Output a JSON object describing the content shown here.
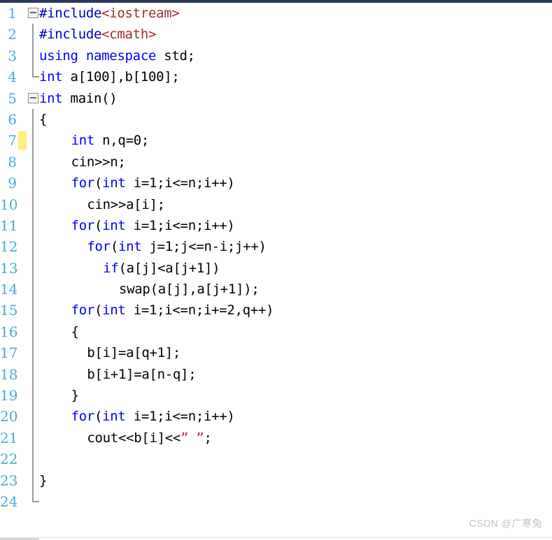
{
  "editor": {
    "language": "C++",
    "total_lines": 24,
    "colors": {
      "keyword": "#0000ff",
      "preprocessor": "#0000c8",
      "header": "#a52a2a",
      "string": "#c03030",
      "plain_text": "#000000",
      "line_number": "#4aa8d8",
      "modified_marker": "#ffef80",
      "fold_guide": "#9a9a9a",
      "background": "#ffffff",
      "top_strip": "#2b3a5c"
    }
  },
  "lines": [
    {
      "number": "1",
      "indent": 0,
      "fold": "open",
      "guide": "none",
      "modified": false,
      "tokens": [
        {
          "t": "#include",
          "c": "pre"
        },
        {
          "t": "<iostream>",
          "c": "hdr"
        }
      ]
    },
    {
      "number": "2",
      "indent": 0,
      "fold": "none",
      "guide": "line",
      "modified": false,
      "tokens": [
        {
          "t": "#include",
          "c": "pre"
        },
        {
          "t": "<cmath>",
          "c": "hdr"
        }
      ]
    },
    {
      "number": "3",
      "indent": 0,
      "fold": "none",
      "guide": "line",
      "modified": false,
      "tokens": [
        {
          "t": "using",
          "c": "kw"
        },
        {
          "t": " ",
          "c": "plain"
        },
        {
          "t": "namespace",
          "c": "kw"
        },
        {
          "t": " std;",
          "c": "plain"
        }
      ]
    },
    {
      "number": "4",
      "indent": 0,
      "fold": "none",
      "guide": "end",
      "modified": false,
      "tokens": [
        {
          "t": "int",
          "c": "kw"
        },
        {
          "t": " a[100],b[100];",
          "c": "plain"
        }
      ]
    },
    {
      "number": "5",
      "indent": 0,
      "fold": "open",
      "guide": "none",
      "modified": false,
      "tokens": [
        {
          "t": "int",
          "c": "kw"
        },
        {
          "t": " main()",
          "c": "plain"
        }
      ]
    },
    {
      "number": "6",
      "indent": 0,
      "fold": "none",
      "guide": "line",
      "modified": false,
      "tokens": [
        {
          "t": "{",
          "c": "plain"
        }
      ]
    },
    {
      "number": "7",
      "indent": 4,
      "fold": "none",
      "guide": "line",
      "modified": true,
      "tokens": [
        {
          "t": "int",
          "c": "kw"
        },
        {
          "t": " n,q=0;",
          "c": "plain"
        }
      ]
    },
    {
      "number": "8",
      "indent": 4,
      "fold": "none",
      "guide": "line",
      "modified": false,
      "tokens": [
        {
          "t": "cin>>n;",
          "c": "plain"
        }
      ]
    },
    {
      "number": "9",
      "indent": 4,
      "fold": "none",
      "guide": "line",
      "modified": false,
      "tokens": [
        {
          "t": "for",
          "c": "kw"
        },
        {
          "t": "(",
          "c": "plain"
        },
        {
          "t": "int",
          "c": "kw"
        },
        {
          "t": " i=1;i<=n;i++)",
          "c": "plain"
        }
      ]
    },
    {
      "number": "10",
      "indent": 6,
      "fold": "none",
      "guide": "line",
      "modified": false,
      "tokens": [
        {
          "t": "cin>>a[i];",
          "c": "plain"
        }
      ]
    },
    {
      "number": "11",
      "indent": 4,
      "fold": "none",
      "guide": "line",
      "modified": false,
      "tokens": [
        {
          "t": "for",
          "c": "kw"
        },
        {
          "t": "(",
          "c": "plain"
        },
        {
          "t": "int",
          "c": "kw"
        },
        {
          "t": " i=1;i<=n;i++)",
          "c": "plain"
        }
      ]
    },
    {
      "number": "12",
      "indent": 6,
      "fold": "none",
      "guide": "line",
      "modified": false,
      "tokens": [
        {
          "t": "for",
          "c": "kw"
        },
        {
          "t": "(",
          "c": "plain"
        },
        {
          "t": "int",
          "c": "kw"
        },
        {
          "t": " j=1;j<=n-i;j++)",
          "c": "plain"
        }
      ]
    },
    {
      "number": "13",
      "indent": 8,
      "fold": "none",
      "guide": "line",
      "modified": false,
      "tokens": [
        {
          "t": "if",
          "c": "kw"
        },
        {
          "t": "(a[j]<a[j+1])",
          "c": "plain"
        }
      ]
    },
    {
      "number": "14",
      "indent": 10,
      "fold": "none",
      "guide": "line",
      "modified": false,
      "tokens": [
        {
          "t": "swap(a[j],a[j+1]);",
          "c": "plain"
        }
      ]
    },
    {
      "number": "15",
      "indent": 4,
      "fold": "none",
      "guide": "line",
      "modified": false,
      "tokens": [
        {
          "t": "for",
          "c": "kw"
        },
        {
          "t": "(",
          "c": "plain"
        },
        {
          "t": "int",
          "c": "kw"
        },
        {
          "t": " i=1;i<=n;i+=2,q++)",
          "c": "plain"
        }
      ]
    },
    {
      "number": "16",
      "indent": 4,
      "fold": "none",
      "guide": "line",
      "modified": false,
      "tokens": [
        {
          "t": "{",
          "c": "plain"
        }
      ]
    },
    {
      "number": "17",
      "indent": 6,
      "fold": "none",
      "guide": "line",
      "modified": false,
      "tokens": [
        {
          "t": "b[i]=a[q+1];",
          "c": "plain"
        }
      ]
    },
    {
      "number": "18",
      "indent": 6,
      "fold": "none",
      "guide": "line",
      "modified": false,
      "tokens": [
        {
          "t": "b[i+1]=a[n-q];",
          "c": "plain"
        }
      ]
    },
    {
      "number": "19",
      "indent": 4,
      "fold": "none",
      "guide": "line",
      "modified": false,
      "tokens": [
        {
          "t": "}",
          "c": "plain"
        }
      ]
    },
    {
      "number": "20",
      "indent": 4,
      "fold": "none",
      "guide": "line",
      "modified": false,
      "tokens": [
        {
          "t": "for",
          "c": "kw"
        },
        {
          "t": "(",
          "c": "plain"
        },
        {
          "t": "int",
          "c": "kw"
        },
        {
          "t": " i=1;i<=n;i++)",
          "c": "plain"
        }
      ]
    },
    {
      "number": "21",
      "indent": 6,
      "fold": "none",
      "guide": "line",
      "modified": false,
      "tokens": [
        {
          "t": "cout<<b[i]<<",
          "c": "plain"
        },
        {
          "t": "” ”",
          "c": "str"
        },
        {
          "t": ";",
          "c": "plain"
        }
      ]
    },
    {
      "number": "22",
      "indent": 0,
      "fold": "none",
      "guide": "line",
      "modified": false,
      "tokens": []
    },
    {
      "number": "23",
      "indent": 0,
      "fold": "none",
      "guide": "line",
      "modified": false,
      "tokens": [
        {
          "t": "}",
          "c": "plain"
        }
      ]
    },
    {
      "number": "24",
      "indent": 0,
      "fold": "none",
      "guide": "end",
      "modified": false,
      "tokens": []
    }
  ],
  "watermark": {
    "text": "CSDN @广寒兔"
  }
}
